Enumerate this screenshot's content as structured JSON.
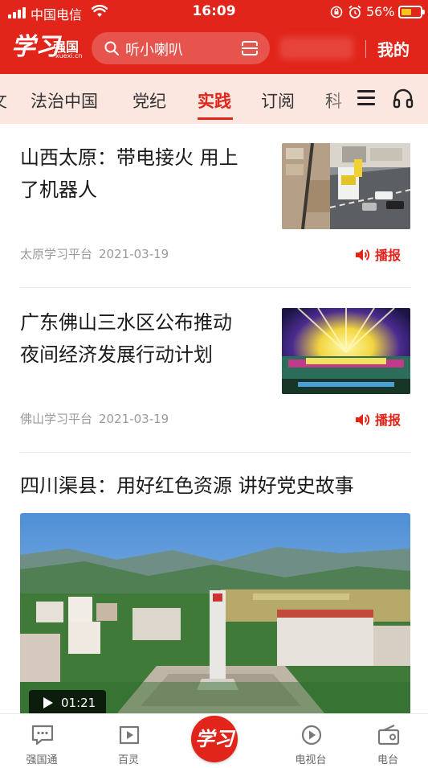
{
  "status_bar": {
    "carrier": "中国电信",
    "time": "16:09",
    "battery_percent": "56%",
    "battery_level": 0.56
  },
  "header": {
    "logo_mark": "学习",
    "logo_brand": "强国",
    "logo_domain": "xuexi.cn",
    "search_placeholder": "听小喇叭",
    "mine_label": "我的"
  },
  "channels": {
    "tabs": [
      {
        "label": "文"
      },
      {
        "label": "法治中国"
      },
      {
        "label": "党纪"
      },
      {
        "label": "实践",
        "active": true
      },
      {
        "label": "订阅"
      },
      {
        "label": "科"
      }
    ]
  },
  "feed": {
    "items": [
      {
        "title_line1": "山西太原：带电接火 用上",
        "title_line2": "了机器人",
        "source": "太原学习平台",
        "date": "2021-03-19",
        "action": "播报"
      },
      {
        "title_line1": "广东佛山三水区公布推动",
        "title_line2": "夜间经济发展行动计划",
        "source": "佛山学习平台",
        "date": "2021-03-19",
        "action": "播报"
      },
      {
        "title_line1": "四川渠县：用好红色资源 讲好党史故事",
        "video_duration": "01:21"
      }
    ]
  },
  "bottom_nav": {
    "items": [
      {
        "label": "强国通"
      },
      {
        "label": "百灵"
      },
      {
        "label": "学习"
      },
      {
        "label": "电视台"
      },
      {
        "label": "电台"
      }
    ]
  },
  "colors": {
    "accent": "#e1251b",
    "tab_bar_bg": "#fbe6e0",
    "meta_text": "#9a9a9a"
  }
}
